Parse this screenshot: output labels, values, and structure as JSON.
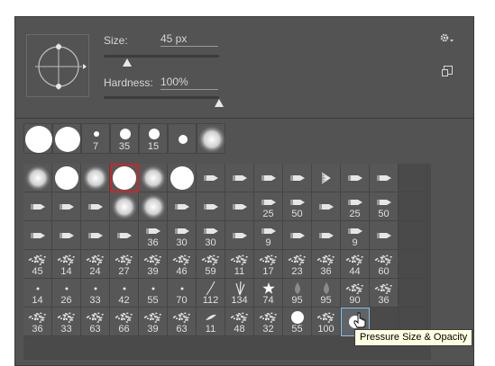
{
  "size": {
    "label": "Size:",
    "value": "45 px",
    "slider_fraction": 0.2
  },
  "hardness": {
    "label": "Hardness:",
    "value": "100%",
    "slider_fraction": 1.0
  },
  "icons": {
    "gear": "gear-icon",
    "new_preset": "new-preset-icon",
    "flyout": "flyout-arrow-icon"
  },
  "colors": {
    "panel": "#535353",
    "selected_outline": "#c8262c",
    "tooltip_bg": "#ffffe1"
  },
  "recent_brushes": [
    {
      "kind": "hard",
      "d": 30,
      "label": ""
    },
    {
      "kind": "hard",
      "d": 28,
      "label": ""
    },
    {
      "kind": "hard",
      "d": 6,
      "label": "7"
    },
    {
      "kind": "hard",
      "d": 12,
      "label": "35"
    },
    {
      "kind": "hard",
      "d": 12,
      "label": "15"
    },
    {
      "kind": "hard",
      "d": 10,
      "label": ""
    },
    {
      "kind": "soft",
      "d": 28,
      "label": ""
    }
  ],
  "brush_grid": [
    {
      "kind": "soft",
      "d": 26,
      "label": ""
    },
    {
      "kind": "hard",
      "d": 26,
      "label": ""
    },
    {
      "kind": "soft",
      "d": 26,
      "label": ""
    },
    {
      "kind": "hard",
      "d": 26,
      "label": "",
      "selected": true
    },
    {
      "kind": "soft",
      "d": 26,
      "label": ""
    },
    {
      "kind": "hard",
      "d": 26,
      "label": ""
    },
    {
      "kind": "tip",
      "label": ""
    },
    {
      "kind": "tip",
      "label": ""
    },
    {
      "kind": "tip",
      "label": ""
    },
    {
      "kind": "tip",
      "label": ""
    },
    {
      "kind": "fan",
      "label": ""
    },
    {
      "kind": "tip",
      "label": ""
    },
    {
      "kind": "tip",
      "label": ""
    },
    {
      "kind": "empty",
      "label": ""
    },
    {
      "kind": "tip",
      "label": ""
    },
    {
      "kind": "tip",
      "label": ""
    },
    {
      "kind": "tip",
      "label": ""
    },
    {
      "kind": "soft",
      "d": 26,
      "label": ""
    },
    {
      "kind": "soft",
      "d": 26,
      "label": ""
    },
    {
      "kind": "tip",
      "label": ""
    },
    {
      "kind": "tip",
      "label": ""
    },
    {
      "kind": "tip",
      "label": ""
    },
    {
      "kind": "tip",
      "label": "25"
    },
    {
      "kind": "tip",
      "label": "50"
    },
    {
      "kind": "tip",
      "label": ""
    },
    {
      "kind": "tip",
      "label": "25"
    },
    {
      "kind": "tip",
      "label": "50"
    },
    {
      "kind": "empty",
      "label": ""
    },
    {
      "kind": "tip",
      "label": ""
    },
    {
      "kind": "tip",
      "label": ""
    },
    {
      "kind": "tip",
      "label": ""
    },
    {
      "kind": "tip",
      "label": ""
    },
    {
      "kind": "tip",
      "label": "36"
    },
    {
      "kind": "tip",
      "label": "30"
    },
    {
      "kind": "tip",
      "label": "30"
    },
    {
      "kind": "tip",
      "label": ""
    },
    {
      "kind": "tip",
      "label": "9"
    },
    {
      "kind": "tip",
      "label": ""
    },
    {
      "kind": "tip",
      "label": ""
    },
    {
      "kind": "tip",
      "label": "9"
    },
    {
      "kind": "tip",
      "label": ""
    },
    {
      "kind": "empty",
      "label": ""
    },
    {
      "kind": "tex",
      "label": "45"
    },
    {
      "kind": "tex",
      "label": "14"
    },
    {
      "kind": "tex",
      "label": "24"
    },
    {
      "kind": "tex",
      "label": "27"
    },
    {
      "kind": "tex",
      "label": "39"
    },
    {
      "kind": "tex",
      "label": "46"
    },
    {
      "kind": "tex",
      "label": "59"
    },
    {
      "kind": "tex",
      "label": "11"
    },
    {
      "kind": "tex",
      "label": "17"
    },
    {
      "kind": "tex",
      "label": "23"
    },
    {
      "kind": "tex",
      "label": "36"
    },
    {
      "kind": "tex",
      "label": "44"
    },
    {
      "kind": "tex",
      "label": "60"
    },
    {
      "kind": "empty",
      "label": ""
    },
    {
      "kind": "dot",
      "label": "14"
    },
    {
      "kind": "dot",
      "label": "26"
    },
    {
      "kind": "dot",
      "label": "33"
    },
    {
      "kind": "dot",
      "label": "42"
    },
    {
      "kind": "dot",
      "label": "55"
    },
    {
      "kind": "dot",
      "label": "70"
    },
    {
      "kind": "stroke",
      "label": "112"
    },
    {
      "kind": "grass",
      "label": "134"
    },
    {
      "kind": "star",
      "label": "74"
    },
    {
      "kind": "drop",
      "label": "95"
    },
    {
      "kind": "drop",
      "label": "95"
    },
    {
      "kind": "tex",
      "label": "90"
    },
    {
      "kind": "tex",
      "label": "36"
    },
    {
      "kind": "empty",
      "label": ""
    },
    {
      "kind": "tex",
      "label": "36"
    },
    {
      "kind": "tex",
      "label": "33"
    },
    {
      "kind": "tex",
      "label": "63"
    },
    {
      "kind": "tex",
      "label": "66"
    },
    {
      "kind": "tex",
      "label": "39"
    },
    {
      "kind": "tex",
      "label": "63"
    },
    {
      "kind": "leaf",
      "label": "11"
    },
    {
      "kind": "tex",
      "label": "48"
    },
    {
      "kind": "tex",
      "label": "32"
    },
    {
      "kind": "hard",
      "d": 14,
      "label": "55"
    },
    {
      "kind": "tex",
      "label": "100"
    },
    {
      "kind": "hard",
      "d": 14,
      "label": "",
      "hovered": true
    },
    {
      "kind": "empty",
      "label": ""
    },
    {
      "kind": "empty",
      "label": ""
    }
  ],
  "tooltip": "Pressure Size & Opacity"
}
